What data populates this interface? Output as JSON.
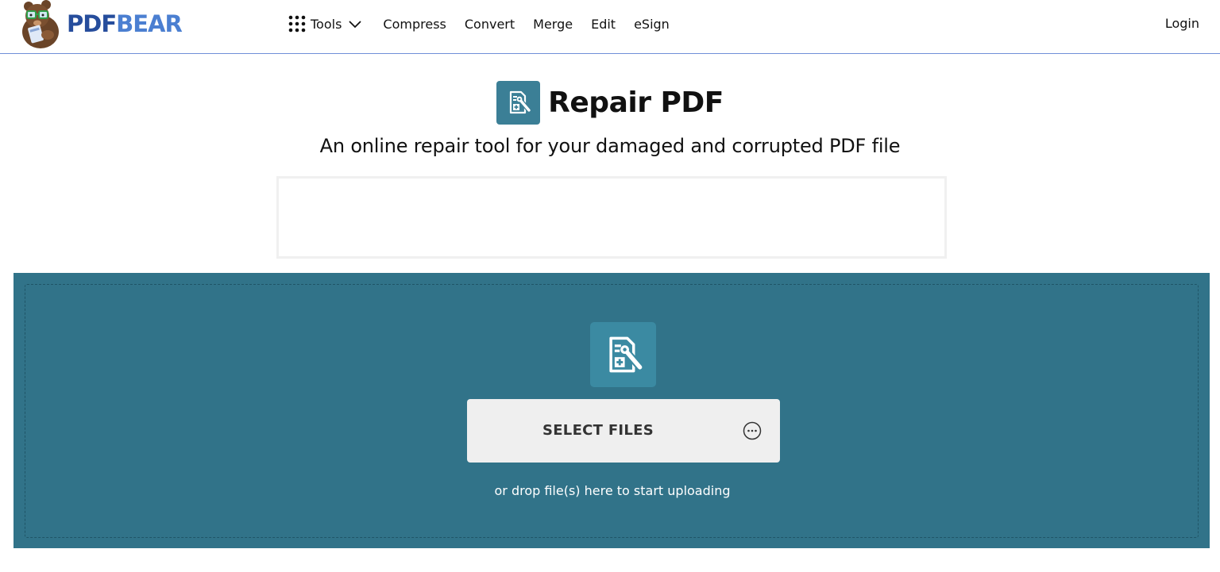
{
  "header": {
    "logo_part1": "PDF",
    "logo_part2": "BEAR",
    "nav": {
      "tools": "Tools",
      "compress": "Compress",
      "convert": "Convert",
      "merge": "Merge",
      "edit": "Edit",
      "esign": "eSign"
    },
    "login": "Login"
  },
  "main": {
    "title": "Repair PDF",
    "subtitle": "An online repair tool for your damaged and corrupted PDF file"
  },
  "upload": {
    "select_label": "SELECT FILES",
    "drop_text": "or drop file(s) here to start uploading"
  },
  "icons": {
    "logo": "bear-mascot-icon",
    "tools": "grid-dots-icon",
    "tools_caret": "chevron-down-icon",
    "tool": "repair-pdf-icon",
    "more": "more-options-icon"
  },
  "colors": {
    "brand_dark": "#264d9c",
    "brand_light": "#4b7fd1",
    "upload_bg": "#317389",
    "tool_icon_bg": "#3b7f96",
    "header_border": "#6f8fd8"
  }
}
